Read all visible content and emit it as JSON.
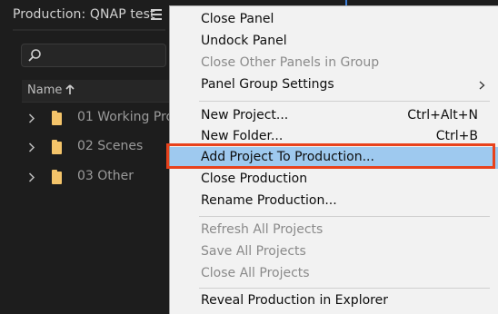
{
  "panel": {
    "title": "Production: QNAP test",
    "column_header": "Name",
    "rows": [
      {
        "label": "01 Working Pro"
      },
      {
        "label": "02 Scenes"
      },
      {
        "label": "03 Other"
      }
    ],
    "folder_color": "#f4c46a"
  },
  "menu": {
    "items": [
      {
        "label": "Close Panel",
        "shortcut": "",
        "enabled": true
      },
      {
        "label": "Undock Panel",
        "shortcut": "",
        "enabled": true
      },
      {
        "label": "Close Other Panels in Group",
        "shortcut": "",
        "enabled": false
      },
      {
        "label": "Panel Group Settings",
        "shortcut": "",
        "enabled": true,
        "submenu": true
      },
      {
        "label": "New Project...",
        "shortcut": "Ctrl+Alt+N",
        "enabled": true
      },
      {
        "label": "New Folder...",
        "shortcut": "Ctrl+B",
        "enabled": true
      },
      {
        "label": "Add Project To Production...",
        "shortcut": "",
        "enabled": true,
        "highlighted": true
      },
      {
        "label": "Close Production",
        "shortcut": "",
        "enabled": true
      },
      {
        "label": "Rename Production...",
        "shortcut": "",
        "enabled": true
      },
      {
        "label": "Refresh All Projects",
        "shortcut": "",
        "enabled": false
      },
      {
        "label": "Save All Projects",
        "shortcut": "",
        "enabled": false
      },
      {
        "label": "Close All Projects",
        "shortcut": "",
        "enabled": false
      },
      {
        "label": "Reveal Production in Explorer",
        "shortcut": "",
        "enabled": true
      }
    ],
    "highlight_color": "#9ec9ef",
    "annotation_color": "#e8421c"
  }
}
